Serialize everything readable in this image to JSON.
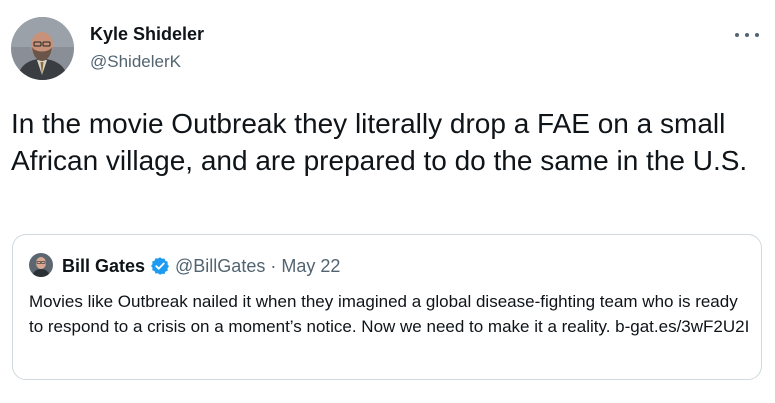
{
  "author": {
    "name": "Kyle Shideler",
    "handle": "@ShidelerK"
  },
  "tweet_text": "In the movie Outbreak they literally drop a FAE on a small African village, and are prepared to do the same in the U.S.",
  "quoted_tweet": {
    "name": "Bill Gates",
    "handle": "@BillGates",
    "separator": "·",
    "date": "May 22",
    "text": "Movies like Outbreak nailed it when they imagined a global disease-fighting team who is ready to respond to a crisis on a moment’s notice. Now we need to make it a reality. b-gat.es/3wF2U2I"
  },
  "colors": {
    "text_primary": "#0f1419",
    "text_secondary": "#536471",
    "border": "#cfd9de",
    "verified_blue": "#1d9bf0"
  },
  "icons": {
    "more": "more-horizontal-icon",
    "verified": "verified-badge-icon"
  }
}
